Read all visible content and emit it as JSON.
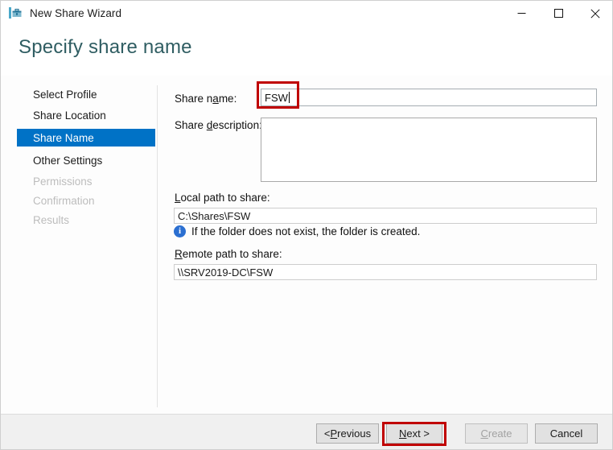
{
  "window": {
    "title": "New Share Wizard",
    "icon": "share-wizard-icon",
    "controls": {
      "minimize": "minimize-icon",
      "maximize": "maximize-icon",
      "close": "close-icon"
    }
  },
  "header": {
    "page_title": "Specify share name",
    "title_color": "#2f5d62"
  },
  "sidebar": {
    "items": [
      {
        "label": "Select Profile",
        "state": "done"
      },
      {
        "label": "Share Location",
        "state": "done"
      },
      {
        "label": "Share Name",
        "state": "selected"
      },
      {
        "label": "Other Settings",
        "state": "done"
      },
      {
        "label": "Permissions",
        "state": "disabled"
      },
      {
        "label": "Confirmation",
        "state": "disabled"
      },
      {
        "label": "Results",
        "state": "disabled"
      }
    ],
    "selected_color": "#0072c6"
  },
  "form": {
    "share_name": {
      "label_pre": "Share n",
      "label_accel": "a",
      "label_post": "me:",
      "value": "FSW",
      "placeholder": ""
    },
    "share_description": {
      "label_pre": "Share ",
      "label_accel": "d",
      "label_post": "escription:",
      "value": "",
      "placeholder": ""
    },
    "local_path": {
      "label_accel": "L",
      "label_post": "ocal path to share:",
      "value": "C:\\Shares\\FSW"
    },
    "info": {
      "icon": "info-icon",
      "text": "If the folder does not exist, the folder is created."
    },
    "remote_path": {
      "label_accel": "R",
      "label_post": "emote path to share:",
      "value": "\\\\SRV2019-DC\\FSW"
    }
  },
  "footer": {
    "buttons": [
      {
        "name": "previous",
        "pre": "< ",
        "accel": "P",
        "post": "revious",
        "state": "enabled"
      },
      {
        "name": "next",
        "pre": "",
        "accel": "N",
        "post": "ext >",
        "state": "enabled"
      },
      {
        "name": "create",
        "pre": "",
        "accel": "C",
        "post": "reate",
        "state": "disabled"
      },
      {
        "name": "cancel",
        "pre": "",
        "accel": "",
        "post": "Cancel",
        "state": "enabled"
      }
    ]
  },
  "annotations": {
    "color": "#c00000",
    "boxes": [
      {
        "name": "share-name-highlight",
        "target": "share-name-input"
      },
      {
        "name": "next-button-highlight",
        "target": "next-button"
      }
    ]
  }
}
